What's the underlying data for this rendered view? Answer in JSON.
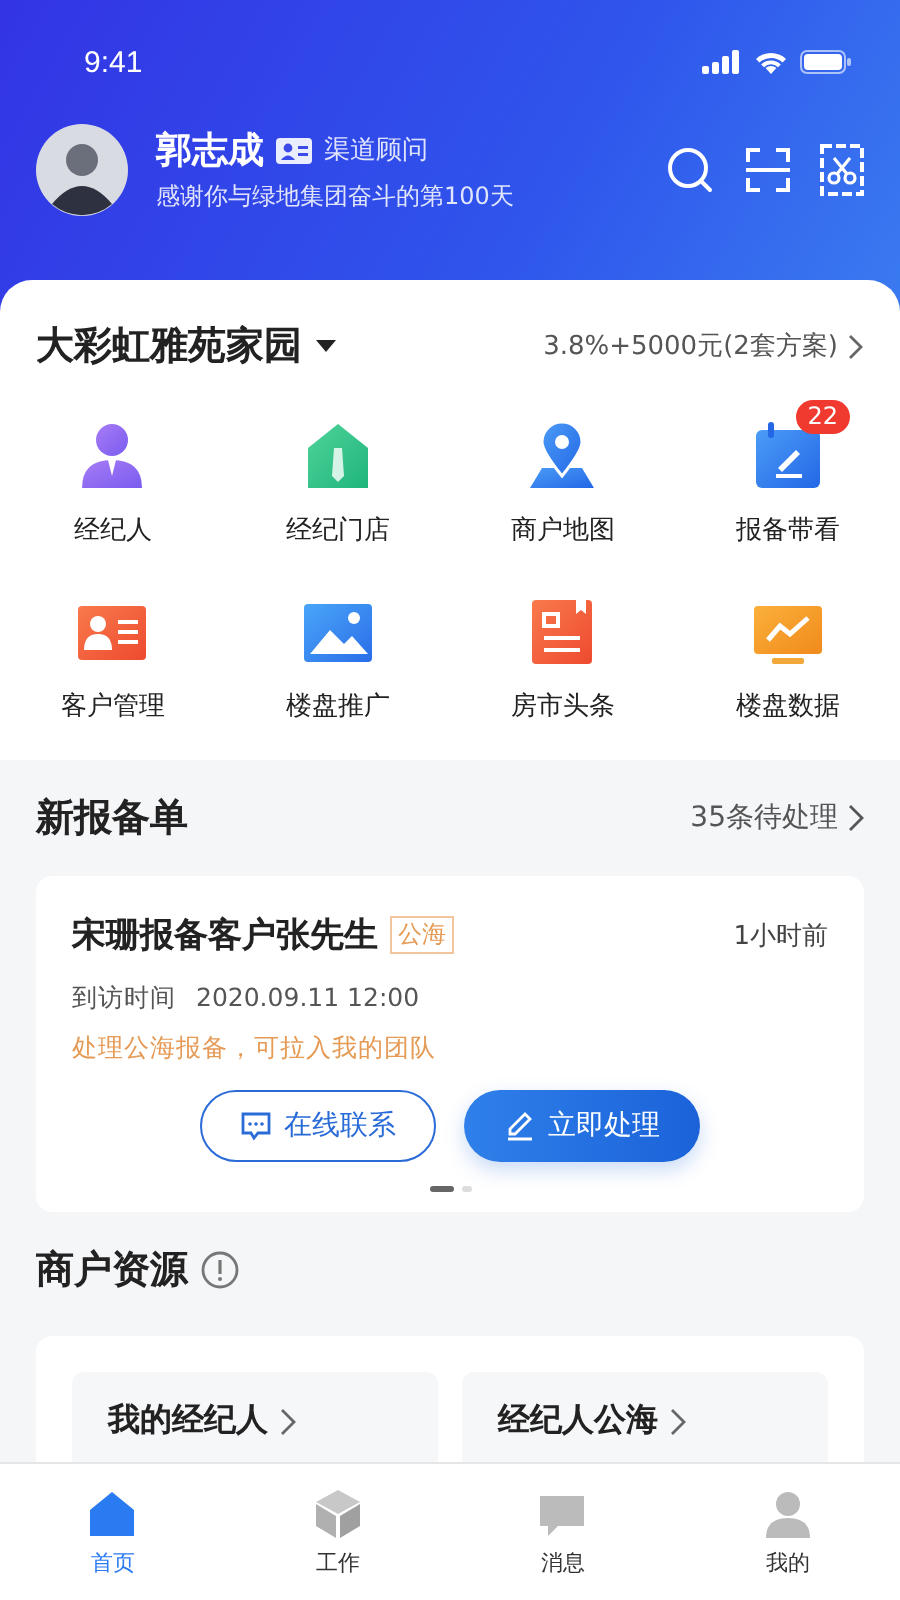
{
  "status_bar": {
    "time": "9:41"
  },
  "user": {
    "name": "郭志成",
    "role": "渠道顾问",
    "greeting": "感谢你与绿地集团奋斗的第100天"
  },
  "project": {
    "name": "大彩虹雅苑家园",
    "commission": "3.8%+5000元(2套方案)"
  },
  "shortcuts": [
    {
      "label": "经纪人",
      "kind": "agent"
    },
    {
      "label": "经纪门店",
      "kind": "store"
    },
    {
      "label": "商户地图",
      "kind": "map"
    },
    {
      "label": "报备带看",
      "kind": "calendar",
      "badge": "22"
    },
    {
      "label": "客户管理",
      "kind": "card"
    },
    {
      "label": "楼盘推广",
      "kind": "image"
    },
    {
      "label": "房市头条",
      "kind": "news"
    },
    {
      "label": "楼盘数据",
      "kind": "chart"
    }
  ],
  "new_reports": {
    "title": "新报备单",
    "pending": "35条待处理",
    "card": {
      "title": "宋珊报备客户张先生",
      "tag": "公海",
      "time": "1小时前",
      "visit_label": "到访时间",
      "visit_time": "2020.09.11 12:00",
      "note": "处理公海报备，可拉入我的团队",
      "buttons": [
        {
          "label": "在线联系",
          "kind": "outline"
        },
        {
          "label": "立即处理",
          "kind": "primary"
        }
      ]
    },
    "pager": [
      {
        "selected": true
      },
      {
        "selected": false
      }
    ]
  },
  "merchant_resources": {
    "title": "商户资源",
    "cards": [
      {
        "label": "我的经纪人"
      },
      {
        "label": "经纪人公海"
      }
    ]
  },
  "tab_bar": [
    {
      "label": "首页",
      "kind": "home",
      "selected": true
    },
    {
      "label": "工作",
      "kind": "work",
      "selected": false
    },
    {
      "label": "消息",
      "kind": "message",
      "selected": false
    },
    {
      "label": "我的",
      "kind": "me",
      "selected": false
    }
  ]
}
